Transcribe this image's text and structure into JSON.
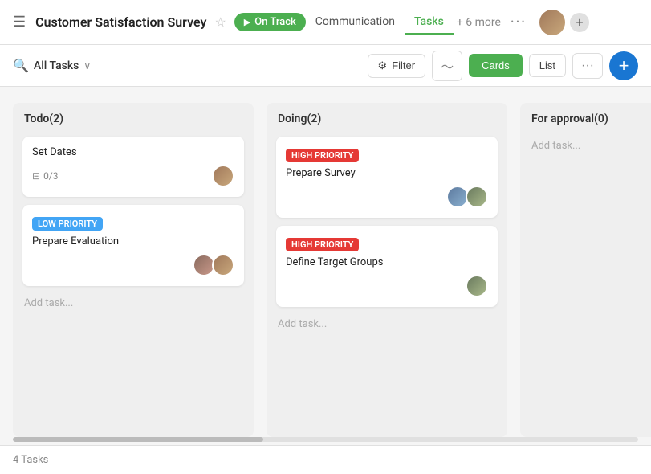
{
  "app": {
    "title": "Customer Satisfaction Survey",
    "status": "On Track",
    "hamburger": "☰",
    "star": "☆",
    "play": "▶"
  },
  "nav": {
    "tabs": [
      {
        "label": "Communication",
        "active": false
      },
      {
        "label": "Tasks",
        "active": true
      },
      {
        "label": "+ 6 more",
        "active": false
      }
    ],
    "more_dots": "···"
  },
  "toolbar": {
    "search_icon": "🔍",
    "all_tasks_label": "All Tasks",
    "chevron": "∨",
    "filter_label": "Filter",
    "cards_label": "Cards",
    "list_label": "List",
    "add_label": "+"
  },
  "columns": [
    {
      "id": "todo",
      "header": "Todo(2)",
      "cards": [
        {
          "id": "set-dates",
          "title": "Set Dates",
          "priority": null,
          "subtask": "0/3",
          "avatars": [
            "face-1"
          ],
          "has_subtask": true
        },
        {
          "id": "prepare-evaluation",
          "title": "Prepare Evaluation",
          "priority": "LOW PRIORITY",
          "priority_class": "priority-low",
          "subtask": null,
          "avatars": [
            "face-3",
            "face-1"
          ],
          "has_subtask": false
        }
      ],
      "add_task_label": "Add task..."
    },
    {
      "id": "doing",
      "header": "Doing(2)",
      "cards": [
        {
          "id": "prepare-survey",
          "title": "Prepare Survey",
          "priority": "HIGH PRIORITY",
          "priority_class": "priority-high",
          "subtask": null,
          "avatars": [
            "face-2",
            "face-4"
          ],
          "has_subtask": false
        },
        {
          "id": "define-target-groups",
          "title": "Define Target Groups",
          "priority": "HIGH PRIORITY",
          "priority_class": "priority-high",
          "subtask": null,
          "avatars": [
            "face-4"
          ],
          "has_subtask": false
        }
      ],
      "add_task_label": "Add task..."
    },
    {
      "id": "for-approval",
      "header": "For approval(0)",
      "cards": [],
      "add_task_label": "Add task..."
    }
  ],
  "footer": {
    "task_count": "4 Tasks"
  }
}
